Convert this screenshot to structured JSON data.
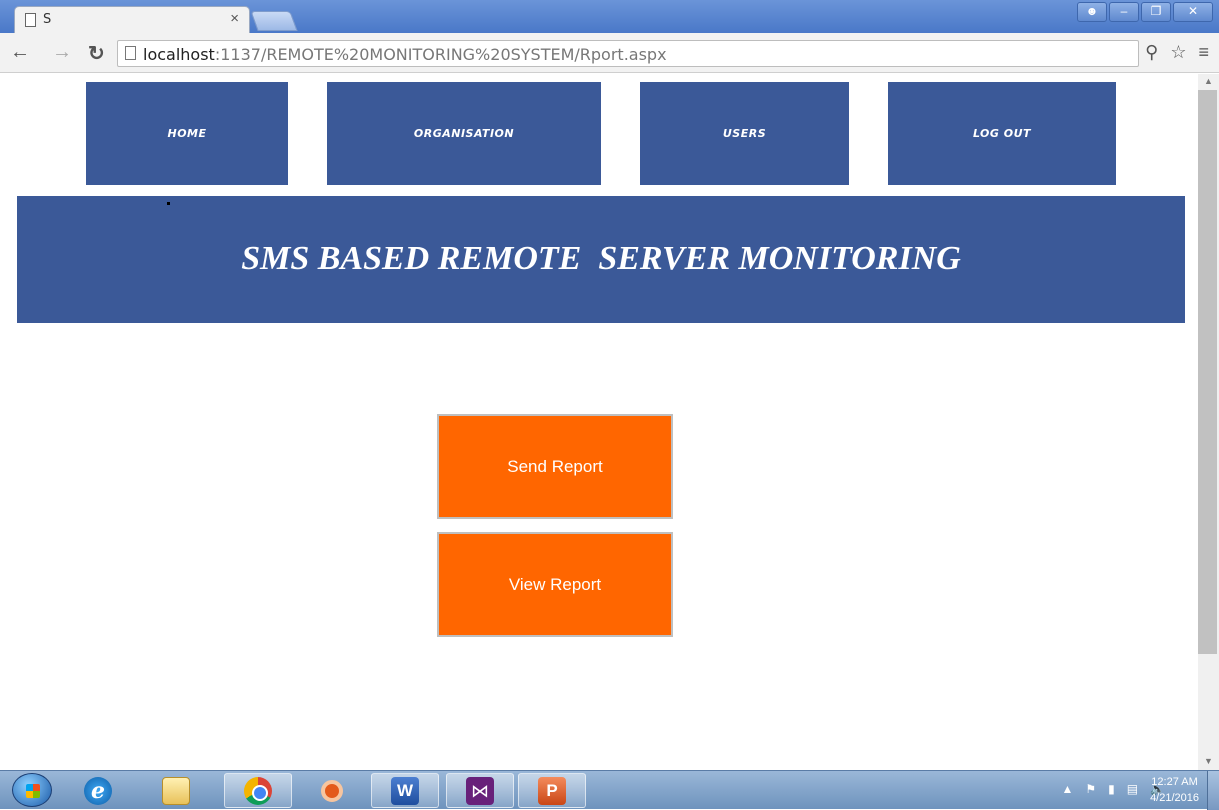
{
  "browser": {
    "tab_title": "S",
    "tab_close": "×",
    "url_host": "localhost",
    "url_rest": ":1137/REMOTE%20MONITORING%20SYSTEM/Rport.aspx"
  },
  "nav": {
    "home": "HOME",
    "organisation": "ORGANISATION",
    "users": "USERS",
    "logout": "LOG OUT"
  },
  "banner": {
    "title": "SMS BASED REMOTE  SERVER MONITORING"
  },
  "actions": {
    "send_report": "Send Report",
    "view_report": "View Report"
  },
  "taskbar": {
    "time": "12:27 AM",
    "date": "4/21/2016"
  },
  "colors": {
    "nav_blue": "#3b5998",
    "action_orange": "#ff6600"
  }
}
